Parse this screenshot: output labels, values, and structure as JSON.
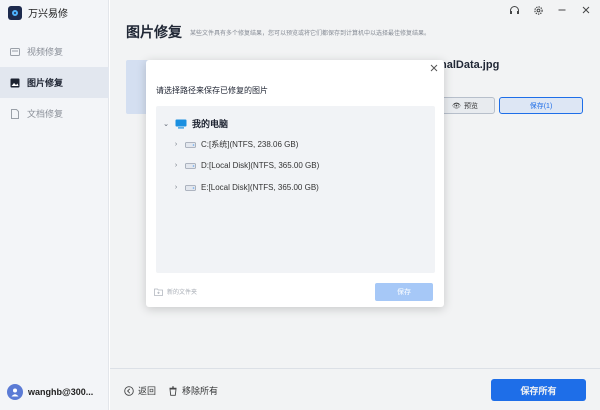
{
  "app": {
    "title": "万兴易修"
  },
  "sidebar": {
    "items": [
      {
        "label": "视频修复",
        "icon": "video-repair-icon"
      },
      {
        "label": "图片修复",
        "icon": "photo-repair-icon",
        "active": true
      },
      {
        "label": "文档修复",
        "icon": "document-repair-icon"
      }
    ],
    "user": {
      "name": "wanghb@300..."
    }
  },
  "topbar": {
    "icons": [
      "headset-icon",
      "settings-gear-icon",
      "minimize-icon",
      "close-icon"
    ]
  },
  "main": {
    "title": "图片修复",
    "subtitle": "某些文件具有多个修复结果，您可以预览或将它们都保存到计算机中以选择最佳修复结果。",
    "file_name": "nalData.jpg",
    "preview_label": "预览",
    "save_label": "保存(1)"
  },
  "footer": {
    "back_label": "返回",
    "remove_all_label": "移除所有",
    "save_all_label": "保存所有"
  },
  "dialog": {
    "title": "请选择路径来保存已修复的图片",
    "root_label": "我的电脑",
    "drives": [
      "C:[系统](NTFS, 238.06  GB)",
      "D:[Local Disk](NTFS, 365.00  GB)",
      "E:[Local Disk](NTFS, 365.00  GB)"
    ],
    "new_folder_label": "新的文件夹",
    "save_label": "保存"
  },
  "colors": {
    "accent": "#1a6ff2",
    "disabled_button": "#a6c8f7",
    "sidebar_bg": "#f3f5f8"
  }
}
